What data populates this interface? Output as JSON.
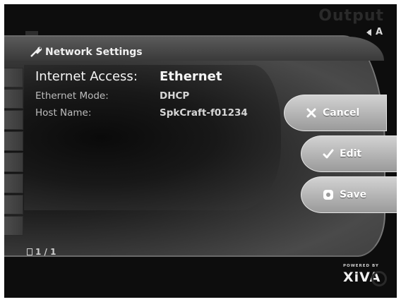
{
  "background": {
    "output_label": "Output",
    "output_sub": "A"
  },
  "panel": {
    "title": "Network Settings",
    "icon": "wrench-icon"
  },
  "settings": {
    "internet_access_label": "Internet Access:",
    "internet_access_value": "Ethernet",
    "ethernet_mode_label": "Ethernet Mode:",
    "ethernet_mode_value": "DHCP",
    "host_name_label": "Host Name:",
    "host_name_value": "SpkCraft-f01234"
  },
  "buttons": {
    "cancel_label": "Cancel",
    "edit_label": "Edit",
    "save_label": "Save"
  },
  "pagination": {
    "text": "1 / 1"
  },
  "branding": {
    "powered_by": "POWERED BY",
    "logo": "XiVA"
  },
  "colors": {
    "button_gradient_top": "#d2d2d2",
    "button_gradient_bottom": "#9a9a9a",
    "panel_dark": "#111111"
  }
}
